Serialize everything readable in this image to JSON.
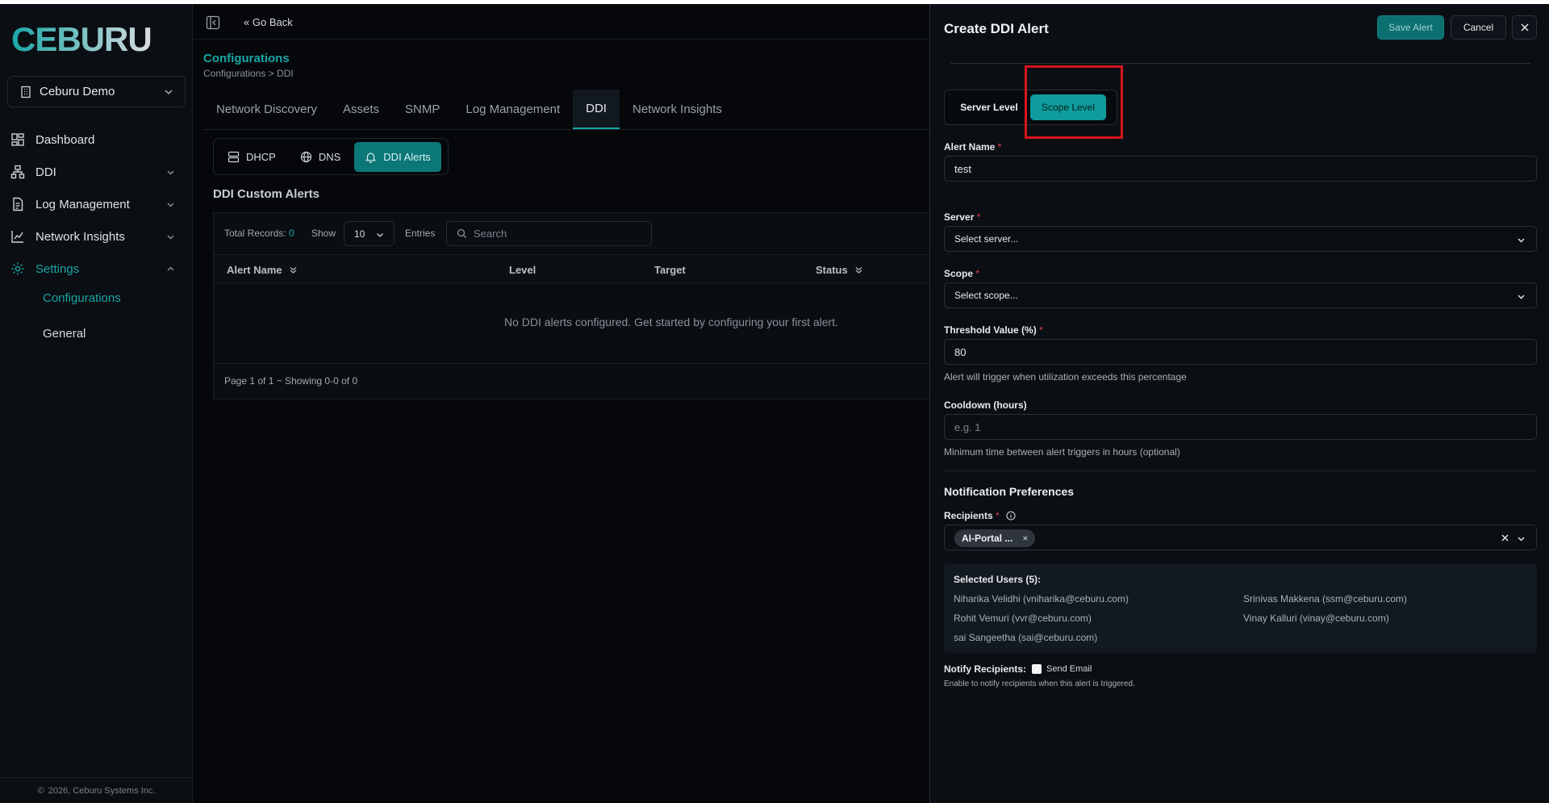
{
  "sidebar": {
    "logo_text": "CEBURU",
    "org": "Ceburu Demo",
    "items": [
      {
        "label": "Dashboard"
      },
      {
        "label": "DDI"
      },
      {
        "label": "Log Management"
      },
      {
        "label": "Network Insights"
      },
      {
        "label": "Settings"
      }
    ],
    "sub_items": [
      {
        "label": "Configurations"
      },
      {
        "label": "General"
      }
    ],
    "copyright": "2026, Ceburu Systems Inc."
  },
  "header": {
    "go_back": "Go Back",
    "page_title": "Configurations",
    "breadcrumb": "Configurations > DDI"
  },
  "tabs": [
    {
      "label": "Network Discovery"
    },
    {
      "label": "Assets"
    },
    {
      "label": "SNMP"
    },
    {
      "label": "Log Management"
    },
    {
      "label": "DDI"
    },
    {
      "label": "Network Insights"
    }
  ],
  "subtabs": [
    {
      "label": "DHCP"
    },
    {
      "label": "DNS"
    },
    {
      "label": "DDI Alerts"
    }
  ],
  "table": {
    "section_title": "DDI Custom Alerts",
    "total_label": "Total Records:",
    "total_value": "0",
    "show_label": "Show",
    "entries_value": "10",
    "entries_label": "Entries",
    "search_placeholder": "Search",
    "columns": [
      "Alert Name",
      "Level",
      "Target",
      "Status"
    ],
    "empty_message": "No DDI alerts configured. Get started by configuring your first alert.",
    "footer": "Page 1 of 1 ~ Showing 0-0 of 0"
  },
  "drawer": {
    "title": "Create DDI Alert",
    "save_label": "Save Alert",
    "cancel_label": "Cancel",
    "level_server": "Server Level",
    "level_scope": "Scope Level",
    "alert_name_label": "Alert Name",
    "alert_name_value": "test",
    "server_label": "Server",
    "server_placeholder": "Select server...",
    "scope_label": "Scope",
    "scope_placeholder": "Select scope...",
    "threshold_label": "Threshold Value (%)",
    "threshold_value": "80",
    "threshold_help": "Alert will trigger when utilization exceeds this percentage",
    "cooldown_label": "Cooldown (hours)",
    "cooldown_placeholder": "e.g. 1",
    "cooldown_help": "Minimum time between alert triggers in hours (optional)",
    "notif_title": "Notification Preferences",
    "recipients_label": "Recipients",
    "recipient_chip": "AI-Portal ...",
    "selected_users_title": "Selected Users (5):",
    "users": [
      "Niharika Velidhi (vniharika@ceburu.com)",
      "Srinivas Makkena (ssm@ceburu.com)",
      "Rohit Vemuri (vvr@ceburu.com)",
      "Vinay Kalluri (vinay@ceburu.com)",
      "sai Sangeetha (sai@ceburu.com)"
    ],
    "notify_label": "Notify Recipients:",
    "send_email_label": "Send Email",
    "notify_help": "Enable to notify recipients when this alert is triggered."
  },
  "colors": {
    "accent": "#1aa6a6",
    "highlight": "#d8141e",
    "background": "#05070b"
  }
}
